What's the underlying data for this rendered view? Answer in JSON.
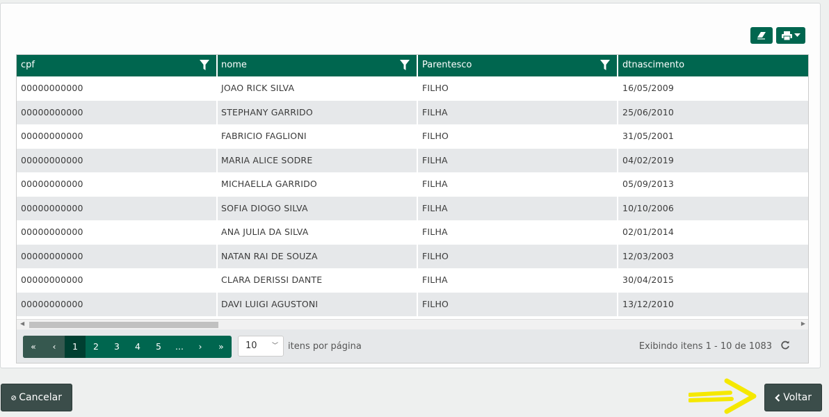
{
  "toolbar": {
    "eraser_icon": "eraser-icon",
    "print_icon": "print-icon"
  },
  "grid": {
    "columns": [
      "cpf",
      "nome",
      "Parentesco",
      "dtnascimento"
    ],
    "rows": [
      [
        "00000000000",
        "JOAO RICK SILVA",
        "FILHO",
        "16/05/2009"
      ],
      [
        "00000000000",
        "STEPHANY GARRIDO",
        "FILHA",
        "25/06/2010"
      ],
      [
        "00000000000",
        "FABRICIO FAGLIONI",
        "FILHO",
        "31/05/2001"
      ],
      [
        "00000000000",
        "MARIA ALICE SODRE",
        "FILHA",
        "04/02/2019"
      ],
      [
        "00000000000",
        "MICHAELLA GARRIDO",
        "FILHA",
        "05/09/2013"
      ],
      [
        "00000000000",
        "SOFIA DIOGO SILVA",
        "FILHA",
        "10/10/2006"
      ],
      [
        "00000000000",
        "ANA JULIA DA SILVA",
        "FILHA",
        "02/01/2014"
      ],
      [
        "00000000000",
        "NATAN RAI DE SOUZA",
        "FILHO",
        "12/03/2003"
      ],
      [
        "00000000000",
        "CLARA DERISSI DANTE",
        "FILHA",
        "30/04/2015"
      ],
      [
        "00000000000",
        "DAVI LUIGI AGUSTONI",
        "FILHO",
        "13/12/2010"
      ]
    ]
  },
  "pager": {
    "first": "«",
    "prev": "‹",
    "pages": [
      "1",
      "2",
      "3",
      "4",
      "5",
      "..."
    ],
    "next": "›",
    "last": "»",
    "per_page_value": "10",
    "per_page_label": "itens por página",
    "info": "Exibindo itens 1 - 10 de 1083"
  },
  "actions": {
    "cancel": "Cancelar",
    "back": "Voltar"
  },
  "colors": {
    "header": "#00664f",
    "button": "#3b4d4a",
    "arrow": "#f5e800"
  }
}
